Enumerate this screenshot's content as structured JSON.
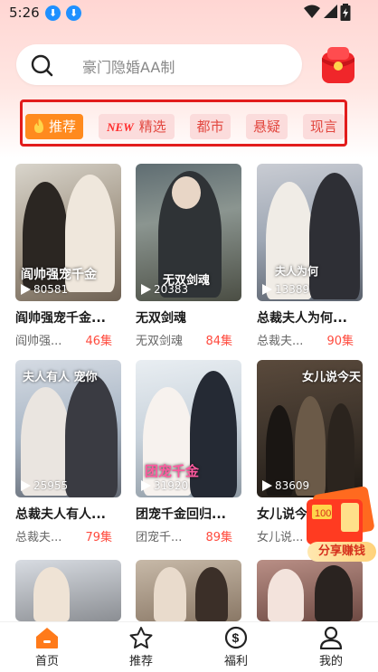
{
  "status_bar": {
    "time": "5:26"
  },
  "search": {
    "placeholder": "豪门隐婚AA制"
  },
  "tabs": [
    {
      "label": "推荐",
      "active": true
    },
    {
      "badge": "NEW",
      "label": "精选"
    },
    {
      "label": "都市"
    },
    {
      "label": "悬疑"
    },
    {
      "label": "现言"
    }
  ],
  "cards": [
    {
      "title": "阎帅强宠千金...",
      "subtitle": "阎帅强...",
      "episodes": "46集",
      "views": "80581",
      "poster_text": "阎帅强宠千金"
    },
    {
      "title": "无双剑魂",
      "subtitle": "无双剑魂",
      "episodes": "84集",
      "views": "20383",
      "poster_text": "无双剑魂"
    },
    {
      "title": "总裁夫人为何...",
      "subtitle": "总裁夫...",
      "episodes": "90集",
      "views": "13389",
      "poster_text": "夫人为何"
    },
    {
      "title": "总裁夫人有人...",
      "subtitle": "总裁夫...",
      "episodes": "79集",
      "views": "25955",
      "poster_text": "夫人有人 宠你"
    },
    {
      "title": "团宠千金回归...",
      "subtitle": "团宠千...",
      "episodes": "89集",
      "views": "31920",
      "poster_text": "团宠千金"
    },
    {
      "title": "女儿说今天...",
      "subtitle": "女儿说...",
      "episodes": "",
      "views": "83609",
      "poster_text": "女儿说今天"
    }
  ],
  "share": {
    "label": "分享赚钱",
    "card_text": "100"
  },
  "bottom_nav": [
    {
      "label": "首页",
      "active": true,
      "icon": "home-icon"
    },
    {
      "label": "推荐",
      "icon": "star-icon"
    },
    {
      "label": "福利",
      "icon": "dollar-icon"
    },
    {
      "label": "我的",
      "icon": "user-icon"
    }
  ],
  "colors": {
    "accent": "#ff8a1e",
    "episode_red": "#ff4a3d",
    "tab_bg": "#fbdcdc",
    "highlight_box": "#e21c1c"
  }
}
